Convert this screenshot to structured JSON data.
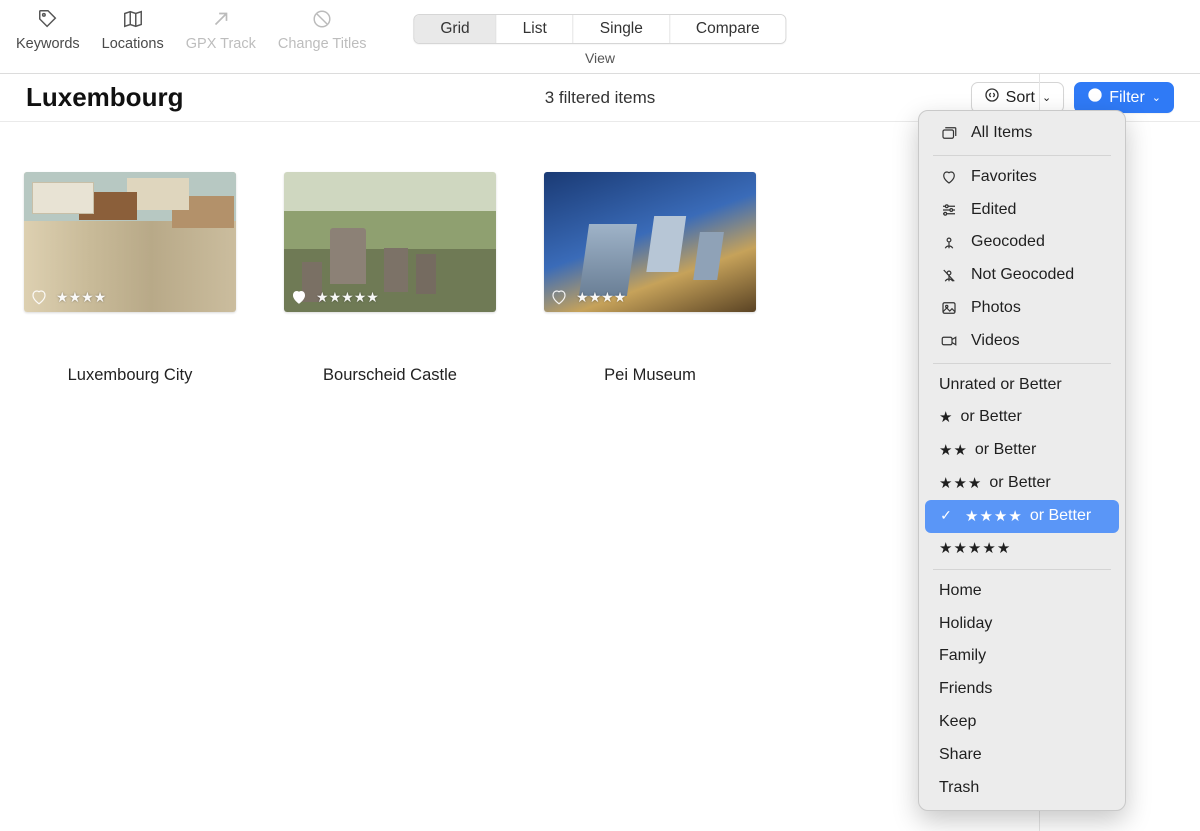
{
  "toolbar": {
    "items": [
      {
        "label": "Keywords",
        "icon": "tag-icon",
        "disabled": false
      },
      {
        "label": "Locations",
        "icon": "map-icon",
        "disabled": false
      },
      {
        "label": "GPX Track",
        "icon": "arrow-up-right-icon",
        "disabled": true
      },
      {
        "label": "Change Titles",
        "icon": "no-sign-icon",
        "disabled": true
      }
    ],
    "view": {
      "options": [
        "Grid",
        "List",
        "Single",
        "Compare"
      ],
      "active": "Grid",
      "group_label": "View"
    }
  },
  "header": {
    "title": "Luxembourg",
    "filtered_text": "3 filtered items",
    "sort": {
      "label": "Sort"
    },
    "filter": {
      "label": "Filter",
      "active": true
    }
  },
  "photos": [
    {
      "title": "Luxembourg City",
      "favorited": false,
      "rating": 4
    },
    {
      "title": "Bourscheid Castle",
      "favorited": true,
      "rating": 5
    },
    {
      "title": "Pei Museum",
      "favorited": false,
      "rating": 4
    }
  ],
  "filter_menu": {
    "all_items": "All Items",
    "categories": [
      {
        "label": "Favorites",
        "icon": "heart-icon"
      },
      {
        "label": "Edited",
        "icon": "sliders-icon"
      },
      {
        "label": "Geocoded",
        "icon": "map-pin-icon"
      },
      {
        "label": "Not Geocoded",
        "icon": "map-pin-off-icon"
      },
      {
        "label": "Photos",
        "icon": "image-icon"
      },
      {
        "label": "Videos",
        "icon": "video-icon"
      }
    ],
    "ratings": [
      {
        "stars": 0,
        "label": "Unrated or Better",
        "selected": false
      },
      {
        "stars": 1,
        "label": "or Better",
        "selected": false
      },
      {
        "stars": 2,
        "label": "or Better",
        "selected": false
      },
      {
        "stars": 3,
        "label": "or Better",
        "selected": false
      },
      {
        "stars": 4,
        "label": "or Better",
        "selected": true
      },
      {
        "stars": 5,
        "label": "",
        "selected": false
      }
    ],
    "keywords": [
      "Home",
      "Holiday",
      "Family",
      "Friends",
      "Keep",
      "Share",
      "Trash"
    ]
  }
}
